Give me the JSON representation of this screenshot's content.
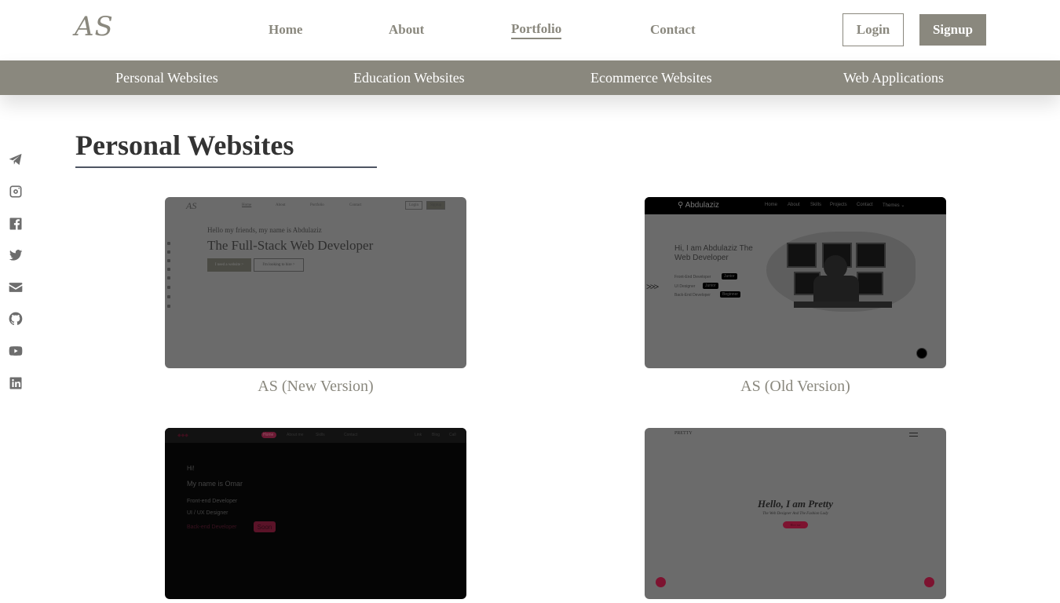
{
  "header": {
    "logo": "AS",
    "nav": [
      "Home",
      "About",
      "Portfolio",
      "Contact"
    ],
    "active_nav": "Portfolio",
    "login_label": "Login",
    "signup_label": "Signup"
  },
  "categories": [
    "Personal Websites",
    "Education Websites",
    "Ecommerce Websites",
    "Web Applications"
  ],
  "social_icons": [
    "telegram-icon",
    "instagram-icon",
    "facebook-icon",
    "twitter-icon",
    "mail-icon",
    "github-icon",
    "youtube-icon",
    "linkedin-icon"
  ],
  "section": {
    "title": "Personal Websites"
  },
  "projects": [
    {
      "caption": "AS (New Version)",
      "preview": {
        "logo": "AS",
        "nav": [
          "Home",
          "About",
          "Portfolio",
          "Contact"
        ],
        "login": "Login",
        "signup": "Signup",
        "greeting": "Hello my friends, my name is Abdulaziz",
        "headline": "The Full-Stack Web Developer",
        "btn_primary": "I need a website >",
        "btn_secondary": "I'm looking to hire >"
      }
    },
    {
      "caption": "AS (Old Version)",
      "preview": {
        "brand": "Abdulaziz",
        "nav": [
          "Home",
          "About",
          "Skills",
          "Projects",
          "Contact",
          "Themes ⌄"
        ],
        "headline": "Hi, I am Abdulaziz The Web Developer",
        "skills": [
          {
            "label": "Front-End Developer",
            "level": "Junior"
          },
          {
            "label": "UI Designer",
            "level": "Junior"
          },
          {
            "label": "Back-End Developer",
            "level": "Beginner"
          }
        ]
      }
    },
    {
      "caption": "",
      "preview": {
        "nav": [
          "Home",
          "About me",
          "Skills",
          "Contact"
        ],
        "extras": [
          "Link",
          "Blog",
          "Call"
        ],
        "hi": "Hi!",
        "name_line": "My name is Omar",
        "roles": [
          "Front-end Developer",
          "UI / UX Designer",
          "Back-end Developer"
        ],
        "soon": "Soon"
      }
    },
    {
      "caption": "",
      "preview": {
        "brand": "PRETTY",
        "headline": "Hello, I am Pretty",
        "subline": "The Web Designer And The Fashion Lady",
        "button": "Hire me"
      }
    }
  ],
  "colors": {
    "accent": "#8a887e",
    "text": "#333333",
    "underline": "#4e5563"
  }
}
